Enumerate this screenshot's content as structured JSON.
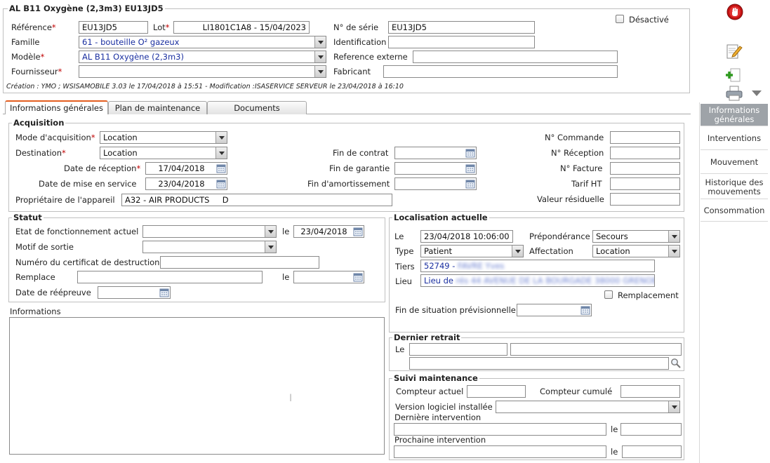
{
  "header": {
    "title": "AL B11 Oxygène (2,3m3) EU13JD5",
    "desactive_label": "Désactivé",
    "reference_label": "Référence",
    "reference_value": "EU13JD5",
    "lot_label": "Lot",
    "lot_value": "LI1801C1A8 - 15/04/2023",
    "serie_label": "N° de série",
    "serie_value": "EU13JD5",
    "famille_label": "Famille",
    "famille_value": "61 - bouteille O² gazeux",
    "identification_label": "Identification",
    "identification_value": "",
    "modele_label": "Modèle",
    "modele_value": "AL B11 Oxygène (2,3m3)",
    "ref_externe_label": "Reference externe",
    "ref_externe_value": "",
    "fournisseur_label": "Fournisseur",
    "fournisseur_value": "",
    "fabricant_label": "Fabricant",
    "fabricant_value": "",
    "audit": "Création : YMO ; WSISAMOBILE 3.03 le 17/04/2018 à 15:51 - Modification :ISASERVICE SERVEUR le 23/04/2018 à 16:10"
  },
  "tabs": [
    {
      "label": "Informations générales"
    },
    {
      "label": "Plan de maintenance"
    },
    {
      "label": "Documents"
    }
  ],
  "acquisition": {
    "legend": "Acquisition",
    "mode_label": "Mode d'acquisition",
    "mode_value": "Location",
    "destination_label": "Destination",
    "destination_value": "Location",
    "date_reception_label": "Date de réception",
    "date_reception_value": "17/04/2018",
    "date_service_label": "Date de mise en service",
    "date_service_value": "23/04/2018",
    "proprietaire_label": "Propriétaire de l'appareil",
    "proprietaire_value": "A32 - AIR PRODUCTS     D",
    "fin_contrat_label": "Fin de contrat",
    "fin_garantie_label": "Fin de garantie",
    "fin_amort_label": "Fin d'amortissement",
    "commande_label": "N° Commande",
    "reception_label": "N° Réception",
    "facture_label": "N° Facture",
    "tarif_label": "Tarif HT",
    "valeur_label": "Valeur résiduelle"
  },
  "statut": {
    "legend": "Statut",
    "etat_label": "Etat de fonctionnement actuel",
    "le_label": "le",
    "etat_date": "23/04/2018",
    "motif_label": "Motif de sortie",
    "certificat_label": "Numéro du certificat de destruction",
    "remplace_label": "Remplace",
    "reepreuve_label": "Date de réépreuve"
  },
  "informations": {
    "label": "Informations"
  },
  "localisation": {
    "legend": "Localisation actuelle",
    "le_label": "Le",
    "le_value": "23/04/2018 10:06:00",
    "prep_label": "Prépondérance",
    "prep_value": "Secours",
    "type_label": "Type",
    "type_value": "Patient",
    "affectation_label": "Affectation",
    "affectation_value": "Location",
    "tiers_label": "Tiers",
    "tiers_value": "52749 -",
    "tiers_hidden": "FAVRE Yves",
    "lieu_label": "Lieu",
    "lieu_value": "Lieu de",
    "lieu_hidden": "rés 44 AVENUE DE LA BOURGADE 38000 GRENOBLE",
    "remplacement_label": "Remplacement",
    "fin_situation_label": "Fin de situation prévisionnelle"
  },
  "dernier_retrait": {
    "legend": "Dernier retrait",
    "le_label": "Le"
  },
  "suivi": {
    "legend": "Suivi maintenance",
    "compteur_actuel_label": "Compteur actuel",
    "compteur_cumule_label": "Compteur cumulé",
    "version_label": "Version logiciel installée",
    "derniere_label": "Dernière intervention",
    "prochaine_label": "Prochaine intervention",
    "le_label": "le"
  },
  "sidebar": {
    "items": [
      {
        "label": "Informations générales"
      },
      {
        "label": "Interventions"
      },
      {
        "label": "Mouvement"
      },
      {
        "label": "Historique des mouvements"
      },
      {
        "label": "Consommation"
      }
    ]
  },
  "toolbar_icons": [
    "stop-icon",
    "edit-icon",
    "add-icon",
    "print-icon",
    "dropdown-arrow-icon"
  ],
  "colors": {
    "tab_accent": "#e35d1f",
    "sidebar_active": "#9ea3a8",
    "required": "#c00000",
    "link_value": "#1a2fa0"
  }
}
